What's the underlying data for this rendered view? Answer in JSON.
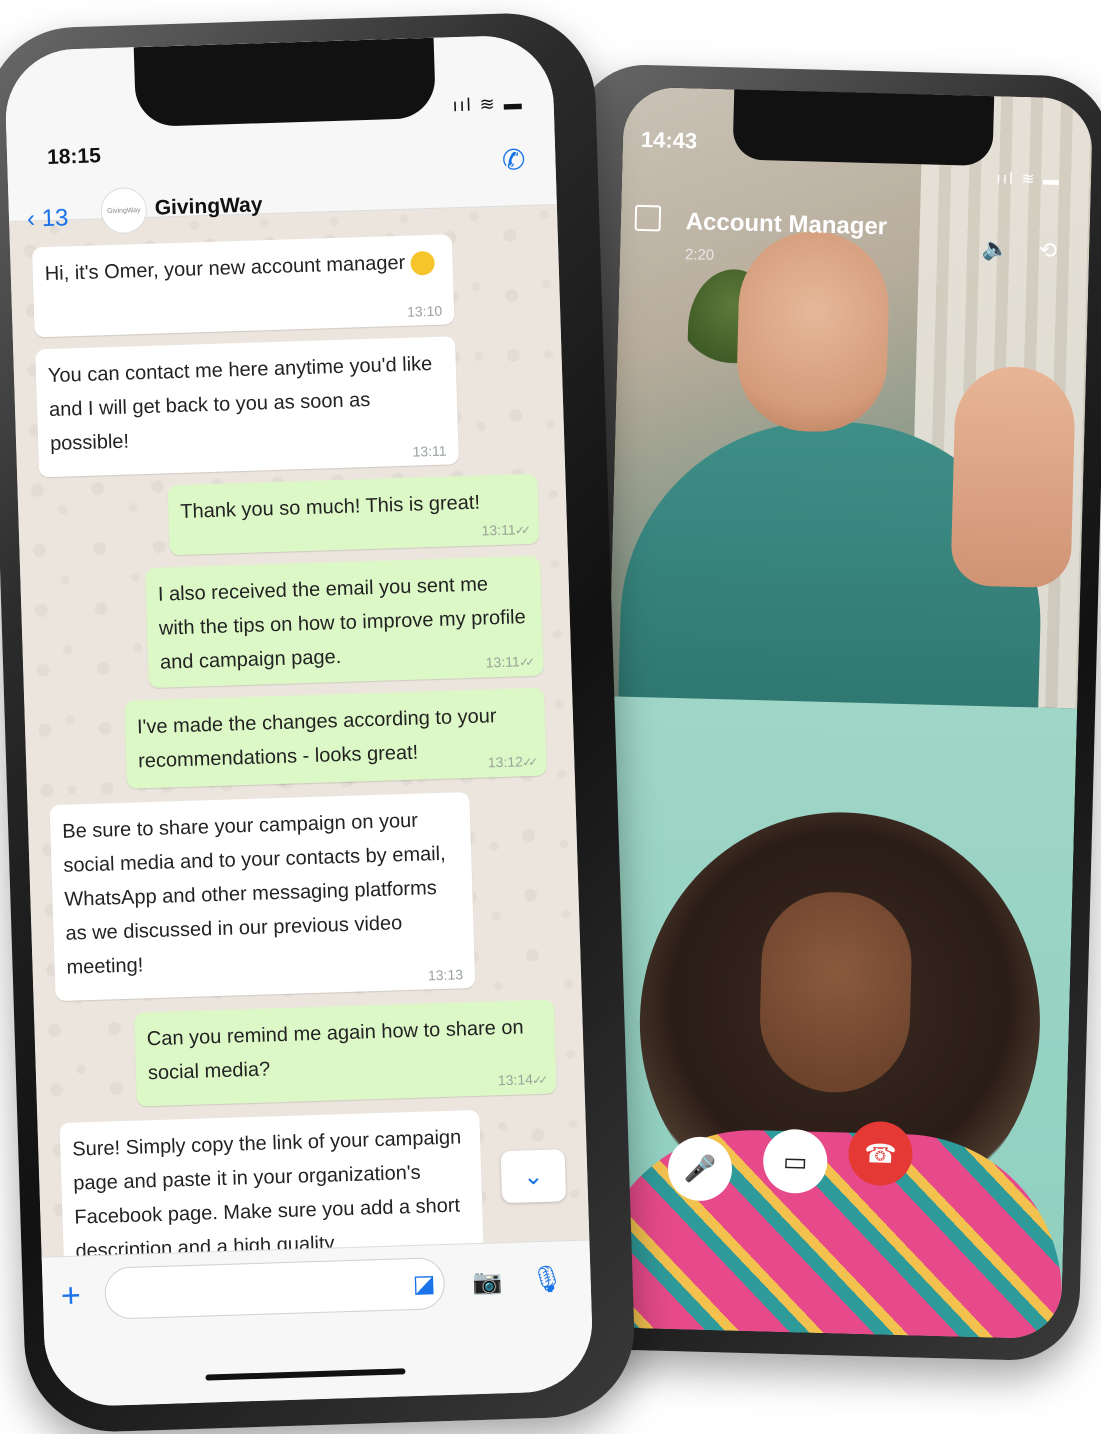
{
  "video_call": {
    "status_time": "14:43",
    "signal": "ııl ≋ ▬",
    "title": "Account Manager",
    "timer": "2:20",
    "icons": {
      "chat": "chat-icon",
      "speaker": "speaker-icon",
      "speaker_glyph": "🔈",
      "camera_switch": "camera-switch-icon",
      "camera_switch_glyph": "⟲",
      "mic": "mic-icon",
      "mic_glyph": "🎤",
      "video": "video-camera-icon",
      "video_glyph": "▭",
      "end": "end-call-icon",
      "end_glyph": "☎"
    },
    "colors": {
      "end_call": "#e53935"
    }
  },
  "chat": {
    "status_time": "18:15",
    "signal": "ııl ≋ ▬",
    "back_count": "13",
    "back_glyph": "‹",
    "contact_name": "GivingWay",
    "avatar_text": "GivingWay",
    "call_add_glyph": "✆",
    "messages": [
      {
        "dir": "in",
        "text": "Hi, it's Omer, your new account manager",
        "time": "13:10",
        "emoji": true
      },
      {
        "dir": "in",
        "text": "You can contact me here anytime you'd like and I will get back to you as soon as possible!",
        "time": "13:11"
      },
      {
        "dir": "out",
        "text": "Thank you so much! This is great!",
        "time": "13:11"
      },
      {
        "dir": "out",
        "text": "I also received the email you sent me with the tips on how to improve my profile and campaign page.",
        "time": "13:11"
      },
      {
        "dir": "out",
        "text": "I've made the changes according to your recommendations - looks great!",
        "time": "13:12"
      },
      {
        "dir": "in",
        "text": "Be sure to share your campaign on your social media and to your contacts by email, WhatsApp and other messaging platforms as we discussed in our previous video meeting!",
        "time": "13:13"
      },
      {
        "dir": "out",
        "text": "Can you remind me again how to share on social media?",
        "time": "13:14"
      },
      {
        "dir": "in",
        "text": "Sure! Simply copy the link of your campaign page and paste it in your organization's Facebook page. Make sure you add a short description and a high quality",
        "time": ""
      }
    ],
    "composer": {
      "input_value": "",
      "plus_glyph": "+",
      "sticker_glyph": "◪",
      "camera_glyph": "📷",
      "mic_glyph": "🎙"
    },
    "scroll_down_glyph": "⌄",
    "colors": {
      "accent": "#1a73e8",
      "outgoing": "#dcf8c6",
      "incoming": "#ffffff"
    }
  }
}
